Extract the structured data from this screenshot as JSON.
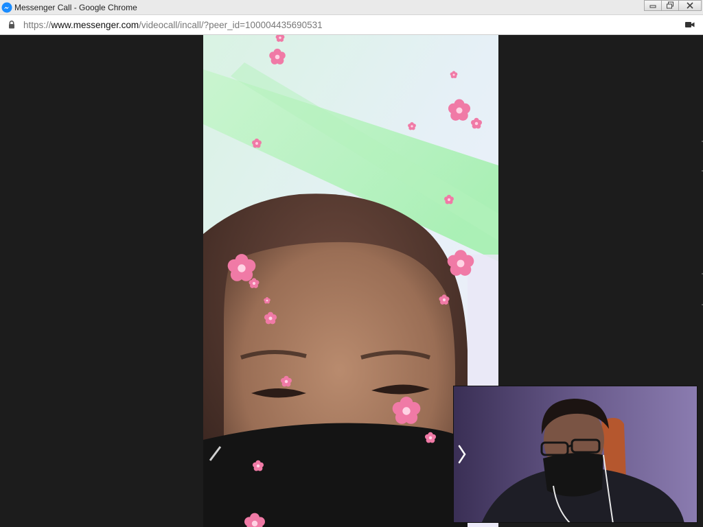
{
  "window": {
    "title": "Messenger Call - Google Chrome",
    "controls": [
      "minimize",
      "restore",
      "close"
    ]
  },
  "address_bar": {
    "url_scheme": "https://",
    "url_host": "www.messenger.com",
    "url_path": "/videocall/incall/?peer_id=100004435690531",
    "secure": true,
    "right_icon": "camera-icon"
  },
  "call": {
    "remote_video_description": "remote participant video feed with pink flower filter",
    "self_view_description": "local camera preview",
    "pip_toggle_glyph": "❭"
  },
  "colors": {
    "background": "#1c1c1c",
    "messenger_blue": "#0a7cff",
    "titlebar": "#eaeaea"
  }
}
